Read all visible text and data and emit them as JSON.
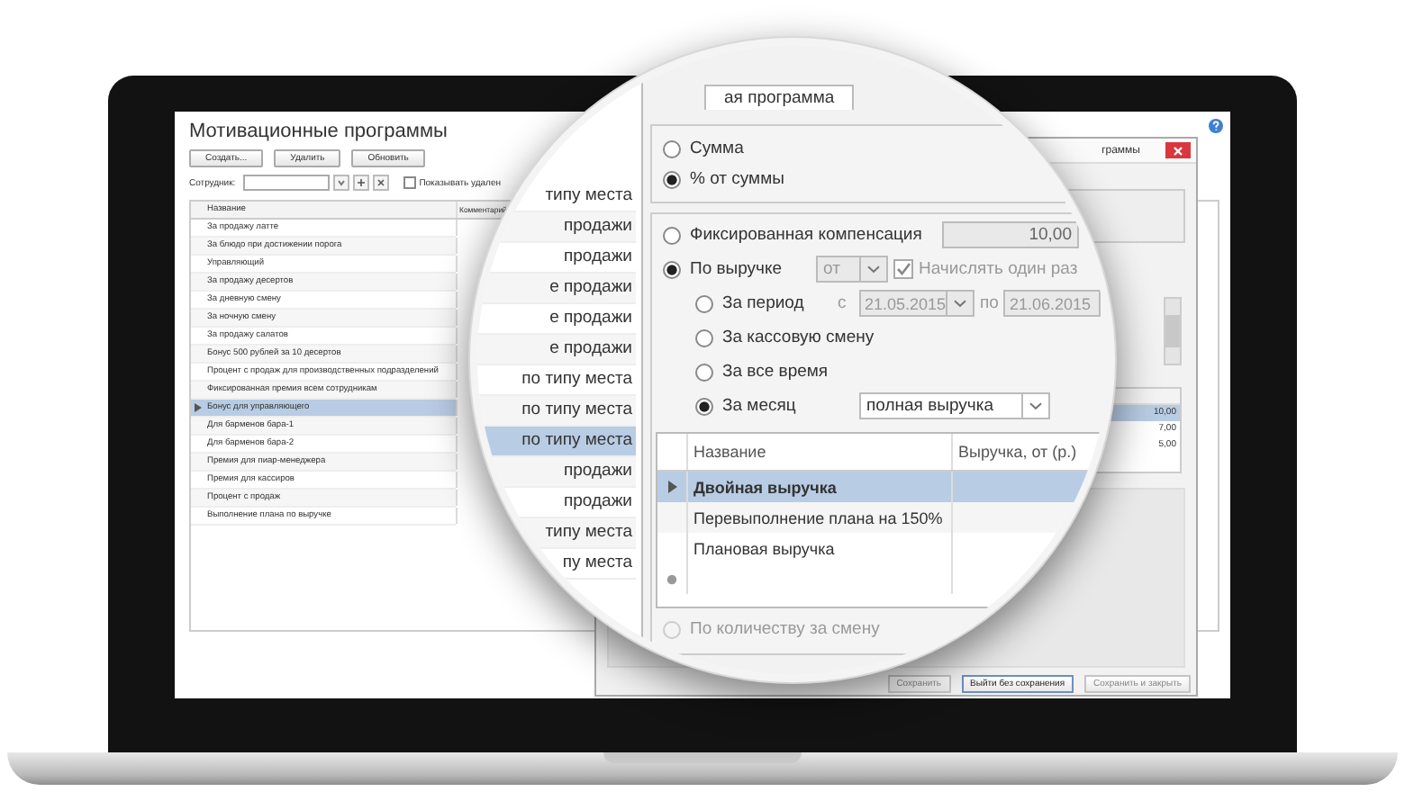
{
  "main_window": {
    "title": "Мотивационные программы",
    "buttons": [
      "Создать...",
      "Удалить",
      "Обновить"
    ],
    "employee_filter": {
      "label": "Сотрудник:"
    },
    "show_deleted": {
      "label": "Показывать удален",
      "checked": false
    },
    "table": {
      "columns": [
        "Название",
        "Комментарий"
      ],
      "rows": [
        {
          "name": "За продажу латте",
          "selected": false
        },
        {
          "name": "За блюдо при достижении порога",
          "selected": false
        },
        {
          "name": "Управляющий",
          "selected": false
        },
        {
          "name": "За продажу десертов",
          "selected": false
        },
        {
          "name": "За дневную смену",
          "selected": false
        },
        {
          "name": "За ночную смену",
          "selected": false
        },
        {
          "name": "За продажу салатов",
          "selected": false
        },
        {
          "name": "Бонус 500 рублей за 10 десертов",
          "selected": false
        },
        {
          "name": "Процент с продаж для производственных подразделений",
          "selected": false
        },
        {
          "name": "Фиксированная премия всем сотрудникам",
          "selected": false
        },
        {
          "name": "Бонус для управляющего",
          "selected": true
        },
        {
          "name": "Для барменов бара-1",
          "selected": false
        },
        {
          "name": "Для барменов бара-2",
          "selected": false
        },
        {
          "name": "Премия для пиар-менеджера",
          "selected": false
        },
        {
          "name": "Премия для кассиров",
          "selected": false
        },
        {
          "name": "Процент с продаж",
          "selected": false
        },
        {
          "name": "Выполнение плана по выручке",
          "selected": false
        }
      ]
    }
  },
  "dialog": {
    "title": "граммы",
    "amounts": [
      {
        "value": "10,00",
        "selected": true
      },
      {
        "value": "7,00",
        "selected": false
      },
      {
        "value": "5,00",
        "selected": false
      }
    ],
    "buttons": [
      {
        "label": "Сохранить",
        "disabled": true
      },
      {
        "label": "Выйти без сохранения",
        "disabled": false
      },
      {
        "label": "Сохранить и закрыть",
        "disabled": true
      }
    ]
  },
  "magnifier": {
    "comment_strip": [
      {
        "text": "типу места",
        "selected": false
      },
      {
        "text": "продажи",
        "selected": false
      },
      {
        "text": "продажи",
        "selected": false
      },
      {
        "text": "е продажи",
        "selected": false
      },
      {
        "text": "е продажи",
        "selected": false
      },
      {
        "text": "е продажи",
        "selected": false
      },
      {
        "text": "по типу места",
        "selected": false
      },
      {
        "text": "по типу места",
        "selected": false
      },
      {
        "text": "по типу места",
        "selected": true
      },
      {
        "text": "продажи",
        "selected": false
      },
      {
        "text": "продажи",
        "selected": false
      },
      {
        "text": "типу места",
        "selected": false
      },
      {
        "text": "пу места",
        "selected": false
      }
    ],
    "tabs": [
      {
        "label": "ая программа",
        "selected": true
      }
    ],
    "calc_type": [
      {
        "label": "Сумма",
        "selected": false
      },
      {
        "label": "% от суммы",
        "selected": true
      }
    ],
    "fixed": {
      "label": "Фиксированная компенсация",
      "selected": false,
      "value": "10,00"
    },
    "by_revenue": {
      "label": "По выручке",
      "selected": true,
      "operator": "от",
      "once": {
        "label": "Начислять один раз",
        "checked": true
      }
    },
    "periods": [
      {
        "kind": "range",
        "label": "За период",
        "selected": false,
        "from_label": "с",
        "from": "21.05.2015",
        "to_label": "по",
        "to": "21.06.2015"
      },
      {
        "kind": "plain",
        "label": "За кассовую смену",
        "selected": false
      },
      {
        "kind": "plain",
        "label": "За все время",
        "selected": false
      },
      {
        "kind": "select",
        "label": "За месяц",
        "selected": true,
        "value": "полная выручка"
      }
    ],
    "table": {
      "columns": [
        "Название",
        "Выручка, от (р.)"
      ],
      "rows": [
        {
          "name": "Двойная выручка",
          "selected": true
        },
        {
          "name": "Перевыполнение плана на 150%",
          "selected": false
        },
        {
          "name": "Плановая выручка",
          "selected": false
        }
      ]
    },
    "by_count": {
      "label": "По количеству за смену",
      "selected": false,
      "disabled": true
    }
  }
}
